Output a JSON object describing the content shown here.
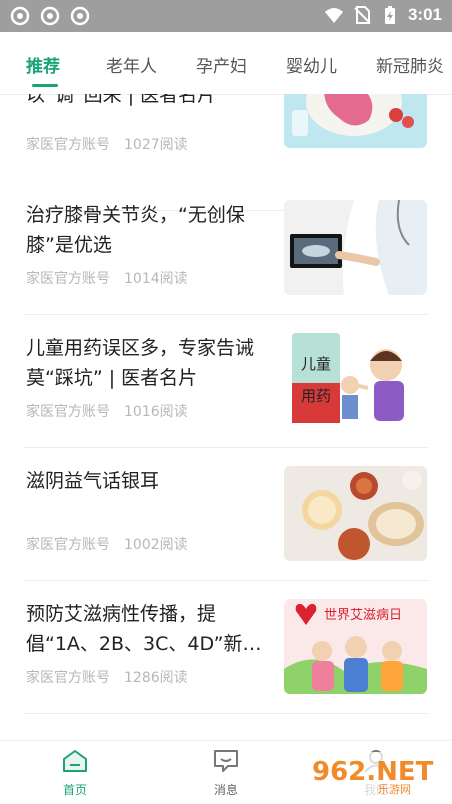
{
  "statusbar": {
    "time": "3:01",
    "left_icons": [
      "notification-app-icon",
      "notification-app-icon",
      "notification-app-icon"
    ],
    "right_icons": [
      "wifi-icon",
      "no-sim-icon",
      "battery-charging-icon"
    ]
  },
  "tabs": [
    {
      "label": "推荐",
      "active": true
    },
    {
      "label": "老年人",
      "active": false
    },
    {
      "label": "孕产妇",
      "active": false
    },
    {
      "label": "婴幼儿",
      "active": false
    },
    {
      "label": "新冠肺炎",
      "active": false
    }
  ],
  "articles": [
    {
      "title": "以“调”回来 | 医者名片",
      "source": "家医官方账号",
      "reads": "1027阅读"
    },
    {
      "title": "治疗膝骨关节炎，“无创保膝”是优选",
      "source": "家医官方账号",
      "reads": "1014阅读"
    },
    {
      "title": "儿童用药误区多，专家告诫莫“踩坑” | 医者名片",
      "source": "家医官方账号",
      "reads": "1016阅读",
      "thumb_text": "儿童用药"
    },
    {
      "title": "滋阴益气话银耳",
      "source": "家医官方账号",
      "reads": "1002阅读"
    },
    {
      "title": "预防艾滋病性传播，提倡“1A、2B、3C、4D”新…",
      "source": "家医官方账号",
      "reads": "1286阅读",
      "thumb_text": "世界艾滋病日"
    }
  ],
  "bottom_nav": [
    {
      "label": "首页",
      "icon": "home-icon",
      "active": true
    },
    {
      "label": "消息",
      "icon": "message-icon",
      "active": false
    },
    {
      "label": "我的",
      "icon": "profile-icon",
      "active": false
    }
  ],
  "watermark": {
    "text": "962.NET",
    "subtext": "乐游网"
  },
  "colors": {
    "accent": "#1aa37a",
    "statusbar": "#9e9e9e",
    "meta": "#b7b7b7"
  }
}
